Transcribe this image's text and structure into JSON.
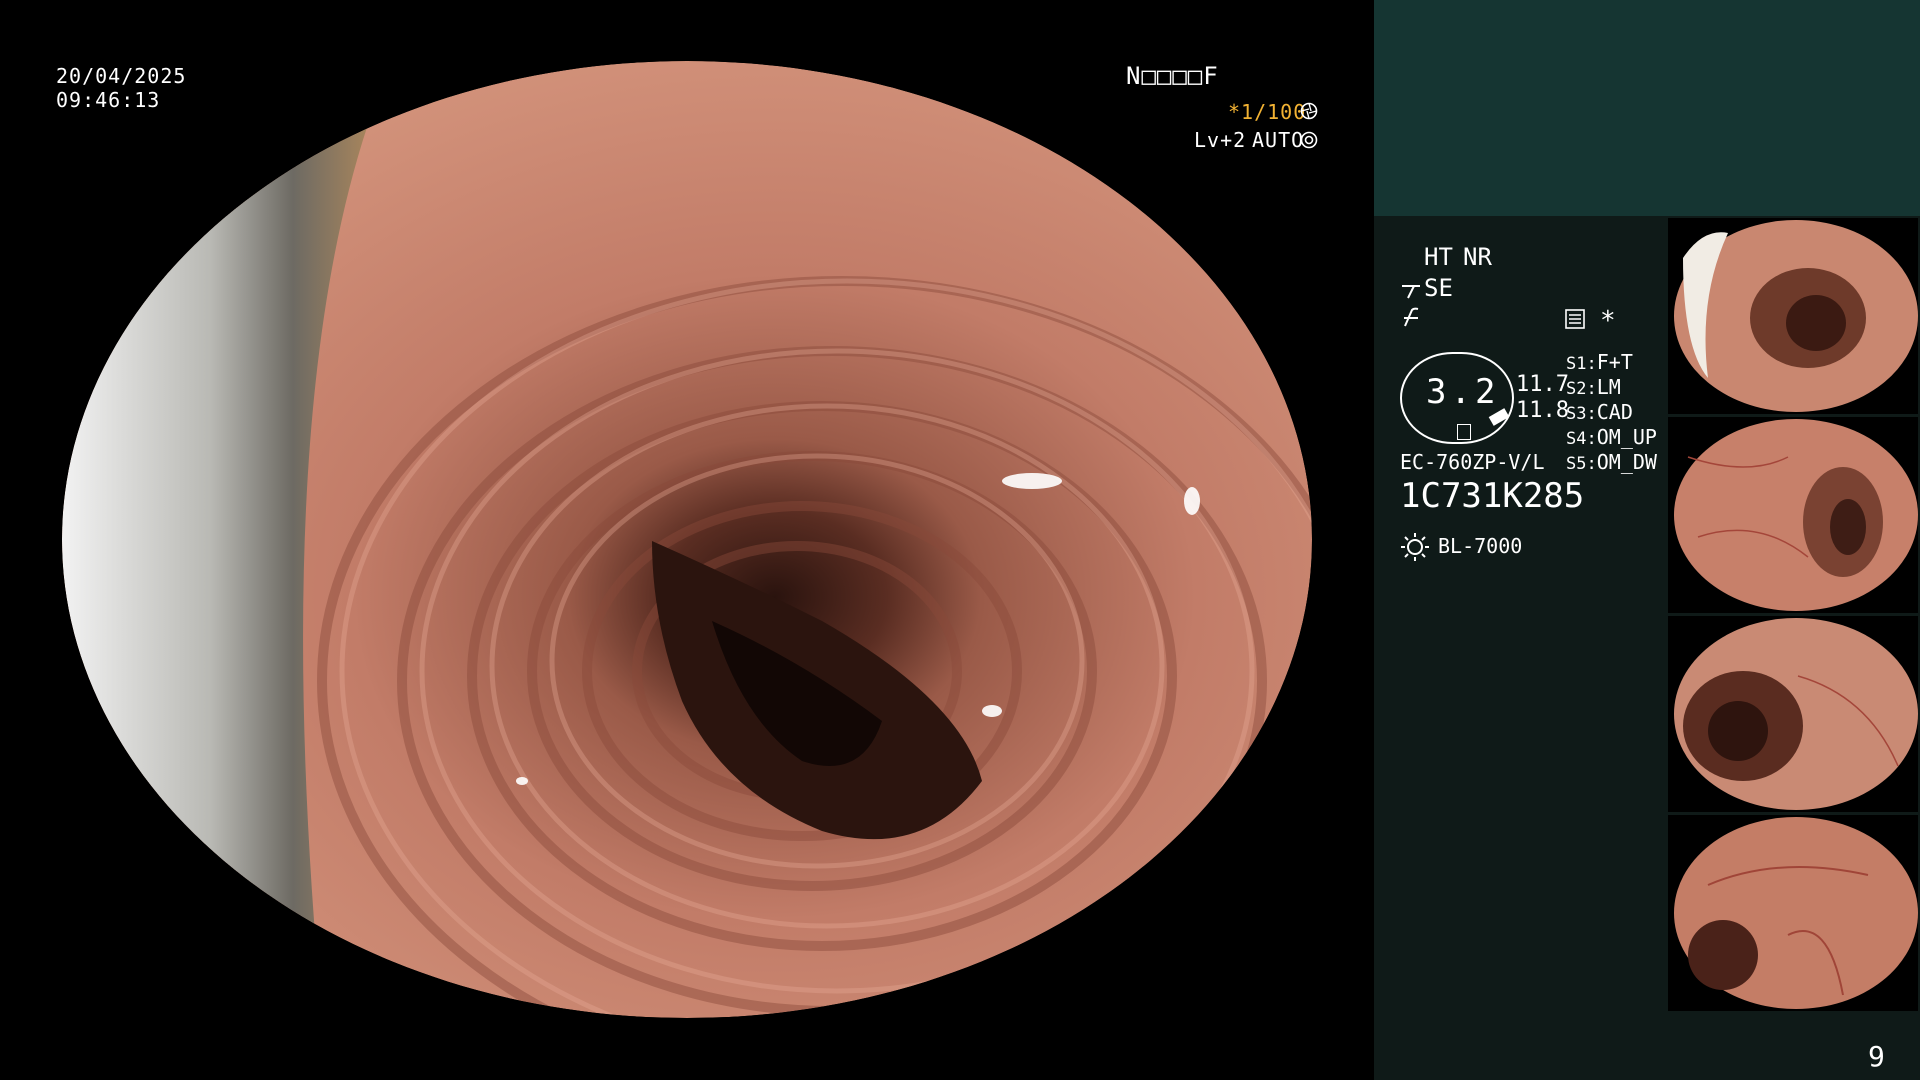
{
  "overlay": {
    "date": "20/04/2025",
    "time": "09:46:13",
    "patient_field": "N□□□□F",
    "shutter": "*1/100",
    "shutter_icon": "aperture-icon",
    "level": "Lv+2",
    "iris": "AUTO",
    "iris_icon": "iris-icon"
  },
  "settings": {
    "ht": "HT",
    "nr": "NR",
    "se": "SE",
    "se_icon": "enhancement-icon",
    "curve_icon": "curve-icon",
    "menu_icon": "settings-menu-icon",
    "asterisk": "*",
    "gauge_value": "3.2",
    "side_values": [
      "11.7",
      "11.8"
    ],
    "scope_model": "EC-760ZP-V/L",
    "scope_serial": "1C731K285",
    "light_icon": "light-source-icon",
    "light_source": "BL-7000"
  },
  "switches": [
    {
      "key": "S1",
      "value": "F+T"
    },
    {
      "key": "S2",
      "value": "LM"
    },
    {
      "key": "S3",
      "value": "CAD"
    },
    {
      "key": "S4",
      "value": "OM_UP"
    },
    {
      "key": "S5",
      "value": "OM_DW"
    }
  ],
  "page_number": "9",
  "colors": {
    "mucosa": "#c9836f",
    "lumen": "#3a1d16",
    "panel": "#0f1a18",
    "panel_top": "#153532",
    "accent": "#f2b233"
  }
}
